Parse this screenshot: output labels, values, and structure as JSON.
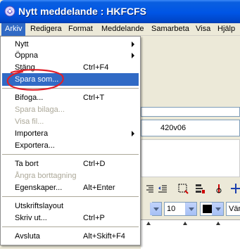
{
  "window": {
    "title": "Nytt meddelande : HKFCFS"
  },
  "menubar": {
    "items": [
      {
        "label": "Arkiv"
      },
      {
        "label": "Redigera"
      },
      {
        "label": "Format"
      },
      {
        "label": "Meddelande"
      },
      {
        "label": "Samarbeta"
      },
      {
        "label": "Visa"
      },
      {
        "label": "Hjälp"
      }
    ]
  },
  "file_menu": {
    "items": [
      {
        "label": "Nytt",
        "submenu": true
      },
      {
        "label": "Öppna",
        "submenu": true
      },
      {
        "label": "Stäng",
        "shortcut": "Ctrl+F4"
      },
      {
        "label": "Spara som...",
        "highlighted": true
      },
      {
        "label": "Bifoga...",
        "shortcut": "Ctrl+T"
      },
      {
        "label": "Spara bilaga...",
        "disabled": true
      },
      {
        "label": "Visa fil...",
        "disabled": true
      },
      {
        "label": "Importera",
        "submenu": true
      },
      {
        "label": "Exportera..."
      },
      {
        "label": "Ta bort",
        "shortcut": "Ctrl+D"
      },
      {
        "label": "Ångra borttagning",
        "disabled": true
      },
      {
        "label": "Egenskaper...",
        "shortcut": "Alt+Enter"
      },
      {
        "label": "Utskriftslayout"
      },
      {
        "label": "Skriv ut...",
        "shortcut": "Ctrl+P"
      },
      {
        "label": "Avsluta",
        "shortcut": "Alt+Skift+F4"
      }
    ]
  },
  "background": {
    "field_text": "420v06",
    "font_size": "10",
    "font_name": "Vän",
    "colors": {
      "accent": "#316ac5",
      "titlebar": "#0055e5",
      "annotation": "#e0202a"
    }
  }
}
